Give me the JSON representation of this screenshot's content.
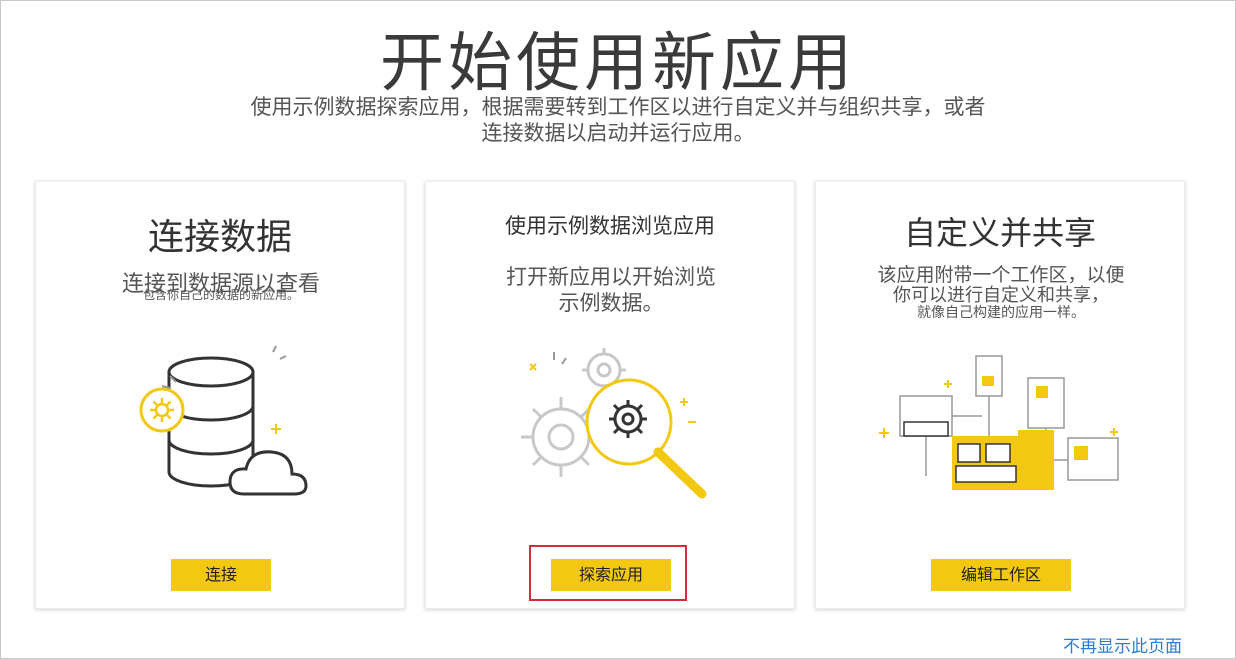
{
  "page": {
    "title": "开始使用新应用",
    "subtitle_line1": "使用示例数据探索应用，根据需要转到工作区以进行自定义并与组织共享，或者",
    "subtitle_line2": "连接数据以启动并运行应用。"
  },
  "cards": [
    {
      "title": "连接数据",
      "desc_line1": "连接到数据源以查看",
      "desc_line2": "包含你自己的数据的新应用。",
      "button_label": "连接",
      "illustration": "database-cloud-gear-icon"
    },
    {
      "title": "使用示例数据浏览应用",
      "desc_line1": "打开新应用以开始浏览",
      "desc_line2": "示例数据。",
      "button_label": "探索应用",
      "illustration": "gears-magnifier-icon"
    },
    {
      "title": "自定义并共享",
      "desc_line1": "该应用附带一个工作区，以便",
      "desc_line2": "你可以进行自定义和共享，",
      "desc_line3": "就像自己构建的应用一样。",
      "button_label": "编辑工作区",
      "illustration": "dashboard-workspace-icon"
    }
  ],
  "footer": {
    "link_label": "不再显示此页面"
  },
  "colors": {
    "accent": "#f2c811",
    "highlight": "#d62b3b",
    "link": "#2b7cd3"
  }
}
